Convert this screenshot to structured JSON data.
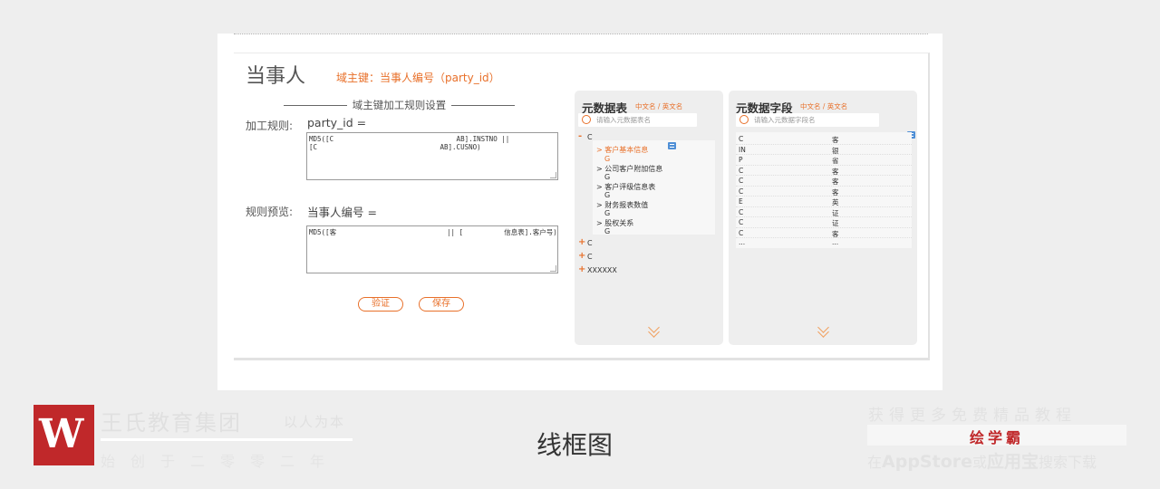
{
  "page": {
    "title": "当事人",
    "domain_key": "域主键：当事人编号（party_id）",
    "section_title": "域主键加工规则设置"
  },
  "rule": {
    "label": "加工规则:",
    "key": "party_id  =",
    "text_line1": "MD5([C                              AB].INSTNO ||",
    "text_line2": "[C                              AB].CUSNO)"
  },
  "preview": {
    "label": "规则预览:",
    "key": "当事人编号  =",
    "text": "MD5([客                           || [          信息表].客户号)"
  },
  "buttons": {
    "verify": "验证",
    "save": "保存"
  },
  "meta_table_panel": {
    "title": "元数据表",
    "subtitle": "中文名 / 英文名",
    "search_placeholder": "请输入元数据表名",
    "root_expanded": {
      "symbol": "-",
      "label": "C"
    },
    "children": [
      {
        "label": "> 客户基本信息",
        "sub": "G",
        "active": true
      },
      {
        "label": "> 公司客户附加信息",
        "sub": "G",
        "active": false
      },
      {
        "label": "> 客户评级信息表",
        "sub": "G",
        "active": false
      },
      {
        "label": "> 财务报表数值",
        "sub": "G",
        "active": false
      },
      {
        "label": "> 股权关系",
        "sub": "G",
        "active": false
      }
    ],
    "collapsed": [
      {
        "symbol": "+",
        "label": "C"
      },
      {
        "symbol": "+",
        "label": "C"
      },
      {
        "symbol": "+",
        "label": "XXXXXX"
      }
    ],
    "expand_icon": "double-chevron-down-icon"
  },
  "meta_field_panel": {
    "title": "元数据字段",
    "subtitle": "中文名 / 英文名",
    "search_placeholder": "请输入元数据字段名",
    "rows": [
      {
        "en": "C",
        "cn": "客"
      },
      {
        "en": "IN",
        "cn": "银"
      },
      {
        "en": "P",
        "cn": "省"
      },
      {
        "en": "C",
        "cn": "客"
      },
      {
        "en": "C",
        "cn": "客"
      },
      {
        "en": "C",
        "cn": "客"
      },
      {
        "en": "E",
        "cn": "英"
      },
      {
        "en": "C",
        "cn": "证"
      },
      {
        "en": "C",
        "cn": "证"
      },
      {
        "en": "C",
        "cn": "客"
      },
      {
        "en": "...",
        "cn": "..."
      }
    ],
    "expand_icon": "double-chevron-down-icon"
  },
  "footer": {
    "logo_letter": "W",
    "brand_name": "王氏教育集团",
    "slogan": "以人为本",
    "founded": "始创于二零零二年",
    "caption": "线框图",
    "promo_top": "获得更多免费精品教程",
    "promo_app": "绘学霸",
    "promo_bottom_1": "在",
    "promo_bottom_appstore": "AppStore",
    "promo_bottom_2": "或",
    "promo_bottom_yyb": "应用宝",
    "promo_bottom_3": "搜索下载"
  },
  "colors": {
    "accent": "#e8702a",
    "brand_red": "#c0282a",
    "panel_bg": "#eeeeee",
    "info_icon": "#4f8fd6"
  }
}
